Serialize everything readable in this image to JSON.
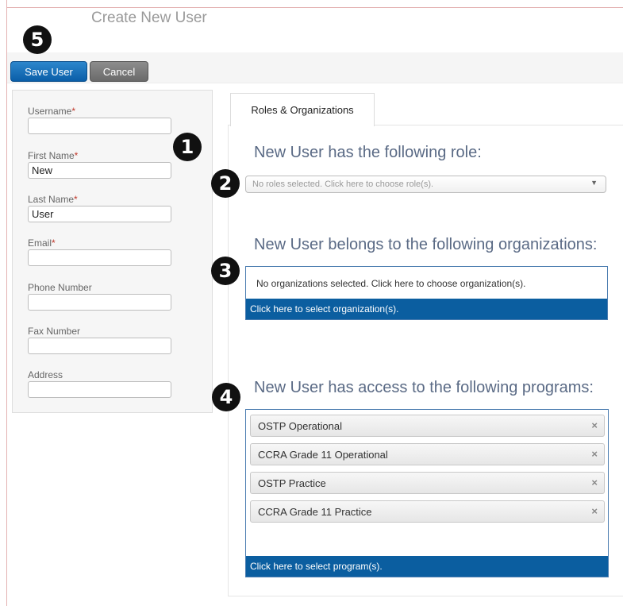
{
  "page_title": "Create New User",
  "badges": [
    "5",
    "1",
    "2",
    "3",
    "4"
  ],
  "toolbar": {
    "save_label": "Save User",
    "cancel_label": "Cancel"
  },
  "form": {
    "required_mark": "*",
    "username": {
      "label": "Username",
      "value": ""
    },
    "first_name": {
      "label": "First Name",
      "value": "New"
    },
    "last_name": {
      "label": "Last Name",
      "value": "User"
    },
    "email": {
      "label": "Email",
      "value": ""
    },
    "phone": {
      "label": "Phone Number",
      "value": ""
    },
    "fax": {
      "label": "Fax Number",
      "value": ""
    },
    "address": {
      "label": "Address",
      "value": ""
    }
  },
  "tabs": [
    {
      "label": "Roles & Organizations"
    }
  ],
  "roles": {
    "heading": "New User has the following role:",
    "placeholder": "No roles selected. Click here to choose role(s)."
  },
  "organizations": {
    "heading": "New User belongs to the following organizations:",
    "empty_text": "No organizations selected.  Click here to choose organization(s).",
    "action": "Click here to select organization(s)."
  },
  "programs": {
    "heading": "New User has access to the following programs:",
    "items": [
      "OSTP Operational",
      "CCRA Grade 11 Operational",
      "OSTP Practice",
      "CCRA Grade 11 Practice"
    ],
    "remove_glyph": "×",
    "action": "Click here to select program(s)."
  },
  "colors": {
    "primary_blue": "#0b5ea0",
    "heading": "#5a6a85",
    "required": "#c0392b"
  }
}
